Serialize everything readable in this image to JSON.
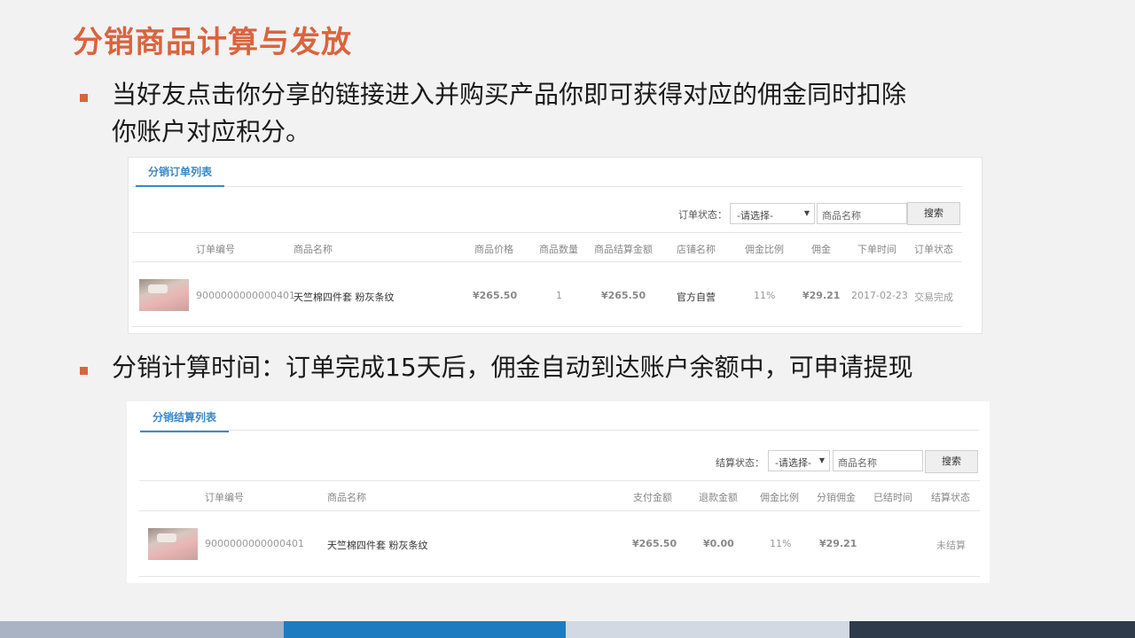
{
  "slide": {
    "title": "分销商品计算与发放",
    "bullet1": "当好友点击你分享的链接进入并购买产品你即可获得对应的佣金同时扣除",
    "bullet1_cont": "你账户对应积分。",
    "bullet2": "分销计算时间：订单完成15天后，佣金自动到达账户余额中，可申请提现"
  },
  "order_panel": {
    "tab": "分销订单列表",
    "filter_label": "订单状态：",
    "select_value": "-请选择-",
    "input_value": "商品名称",
    "search_button": "搜索",
    "headers": [
      "订单编号",
      "商品名称",
      "商品价格",
      "商品数量",
      "商品结算金额",
      "店铺名称",
      "佣金比例",
      "佣金",
      "下单时间",
      "订单状态"
    ],
    "row": {
      "order_no": "9000000000000401",
      "product": "天竺棉四件套 粉灰条纹",
      "price": "¥265.50",
      "qty": "1",
      "settle_amount": "¥265.50",
      "shop": "官方自营",
      "rate": "11%",
      "commission": "¥29.21",
      "date": "2017-02-23",
      "status": "交易完成"
    }
  },
  "settle_panel": {
    "tab": "分销结算列表",
    "filter_label": "结算状态：",
    "select_value": "-请选择-",
    "input_value": "商品名称",
    "search_button": "搜索",
    "headers": [
      "订单编号",
      "商品名称",
      "支付金额",
      "退款金额",
      "佣金比例",
      "分销佣金",
      "已结时间",
      "结算状态"
    ],
    "row": {
      "order_no": "9000000000000401",
      "product": "天竺棉四件套 粉灰条纹",
      "paid": "¥265.50",
      "refund": "¥0.00",
      "rate": "11%",
      "commission": "¥29.21",
      "settled_time": "",
      "status": "未结算"
    }
  },
  "colors": {
    "accent": "#d9643f",
    "tab": "#3a88c8",
    "bar1": "#a9b3c4",
    "bar2": "#1f7bbf",
    "bar3": "#d3d9e3",
    "bar4": "#2f3a4a"
  }
}
